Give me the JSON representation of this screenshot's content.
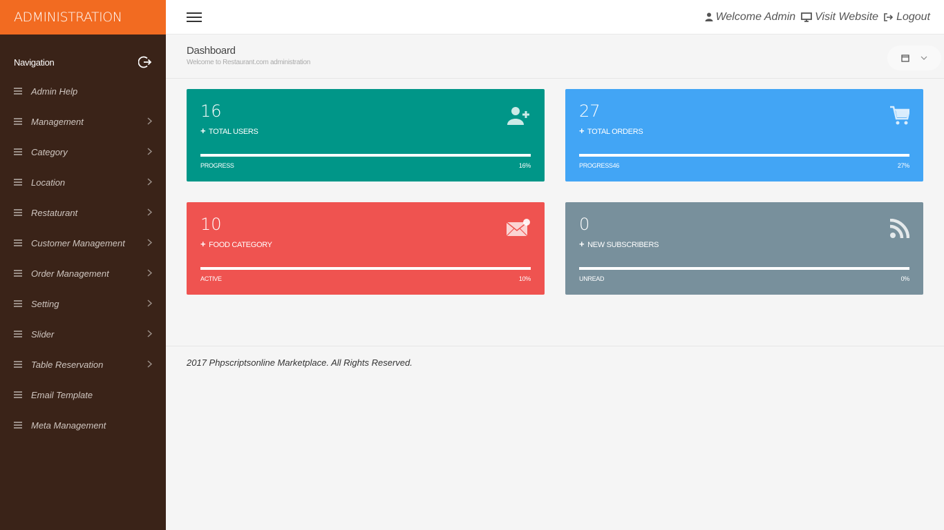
{
  "brand": "ADMINISTRATION",
  "nav": {
    "heading": "Navigation",
    "items": [
      {
        "label": "Admin Help",
        "has_submenu": false
      },
      {
        "label": "Management",
        "has_submenu": true
      },
      {
        "label": "Category",
        "has_submenu": true
      },
      {
        "label": "Location",
        "has_submenu": true
      },
      {
        "label": "Restaturant",
        "has_submenu": true
      },
      {
        "label": "Customer Management",
        "has_submenu": true
      },
      {
        "label": "Order Management",
        "has_submenu": true
      },
      {
        "label": "Setting",
        "has_submenu": true
      },
      {
        "label": "Slider",
        "has_submenu": true
      },
      {
        "label": "Table Reservation",
        "has_submenu": true
      },
      {
        "label": "Email Template",
        "has_submenu": false
      },
      {
        "label": "Meta Management",
        "has_submenu": false
      }
    ]
  },
  "topbar": {
    "welcome": "Welcome Admin",
    "visit": "Visit Website",
    "logout": "Logout"
  },
  "page": {
    "title": "Dashboard",
    "subtitle": "Welcome to Restaurant.com administration"
  },
  "cards": [
    {
      "value": "16",
      "label": "TOTAL USERS",
      "foot_left": "PROGRESS",
      "foot_right": "16%",
      "progress": 1.0,
      "color": "#009688",
      "icon": "add-user-icon"
    },
    {
      "value": "27",
      "label": "TOTAL ORDERS",
      "foot_left": "PROGRESS46",
      "foot_right": "27%",
      "progress": 1.0,
      "color": "#42a5f5",
      "icon": "cart-icon"
    },
    {
      "value": "10",
      "label": "FOOD CATEGORY",
      "foot_left": "ACTIVE",
      "foot_right": "10%",
      "progress": 1.0,
      "color": "#ef5350",
      "icon": "mail-icon"
    },
    {
      "value": "0",
      "label": "NEW SUBSCRIBERS",
      "foot_left": "UNREAD",
      "foot_right": "0%",
      "progress": 1.0,
      "color": "#78909c",
      "icon": "rss-icon"
    }
  ],
  "colors": {
    "brand": "#f26b21",
    "sidebar": "#3a2318"
  },
  "footer": "2017 Phpscriptsonline Marketplace. All Rights Reserved."
}
